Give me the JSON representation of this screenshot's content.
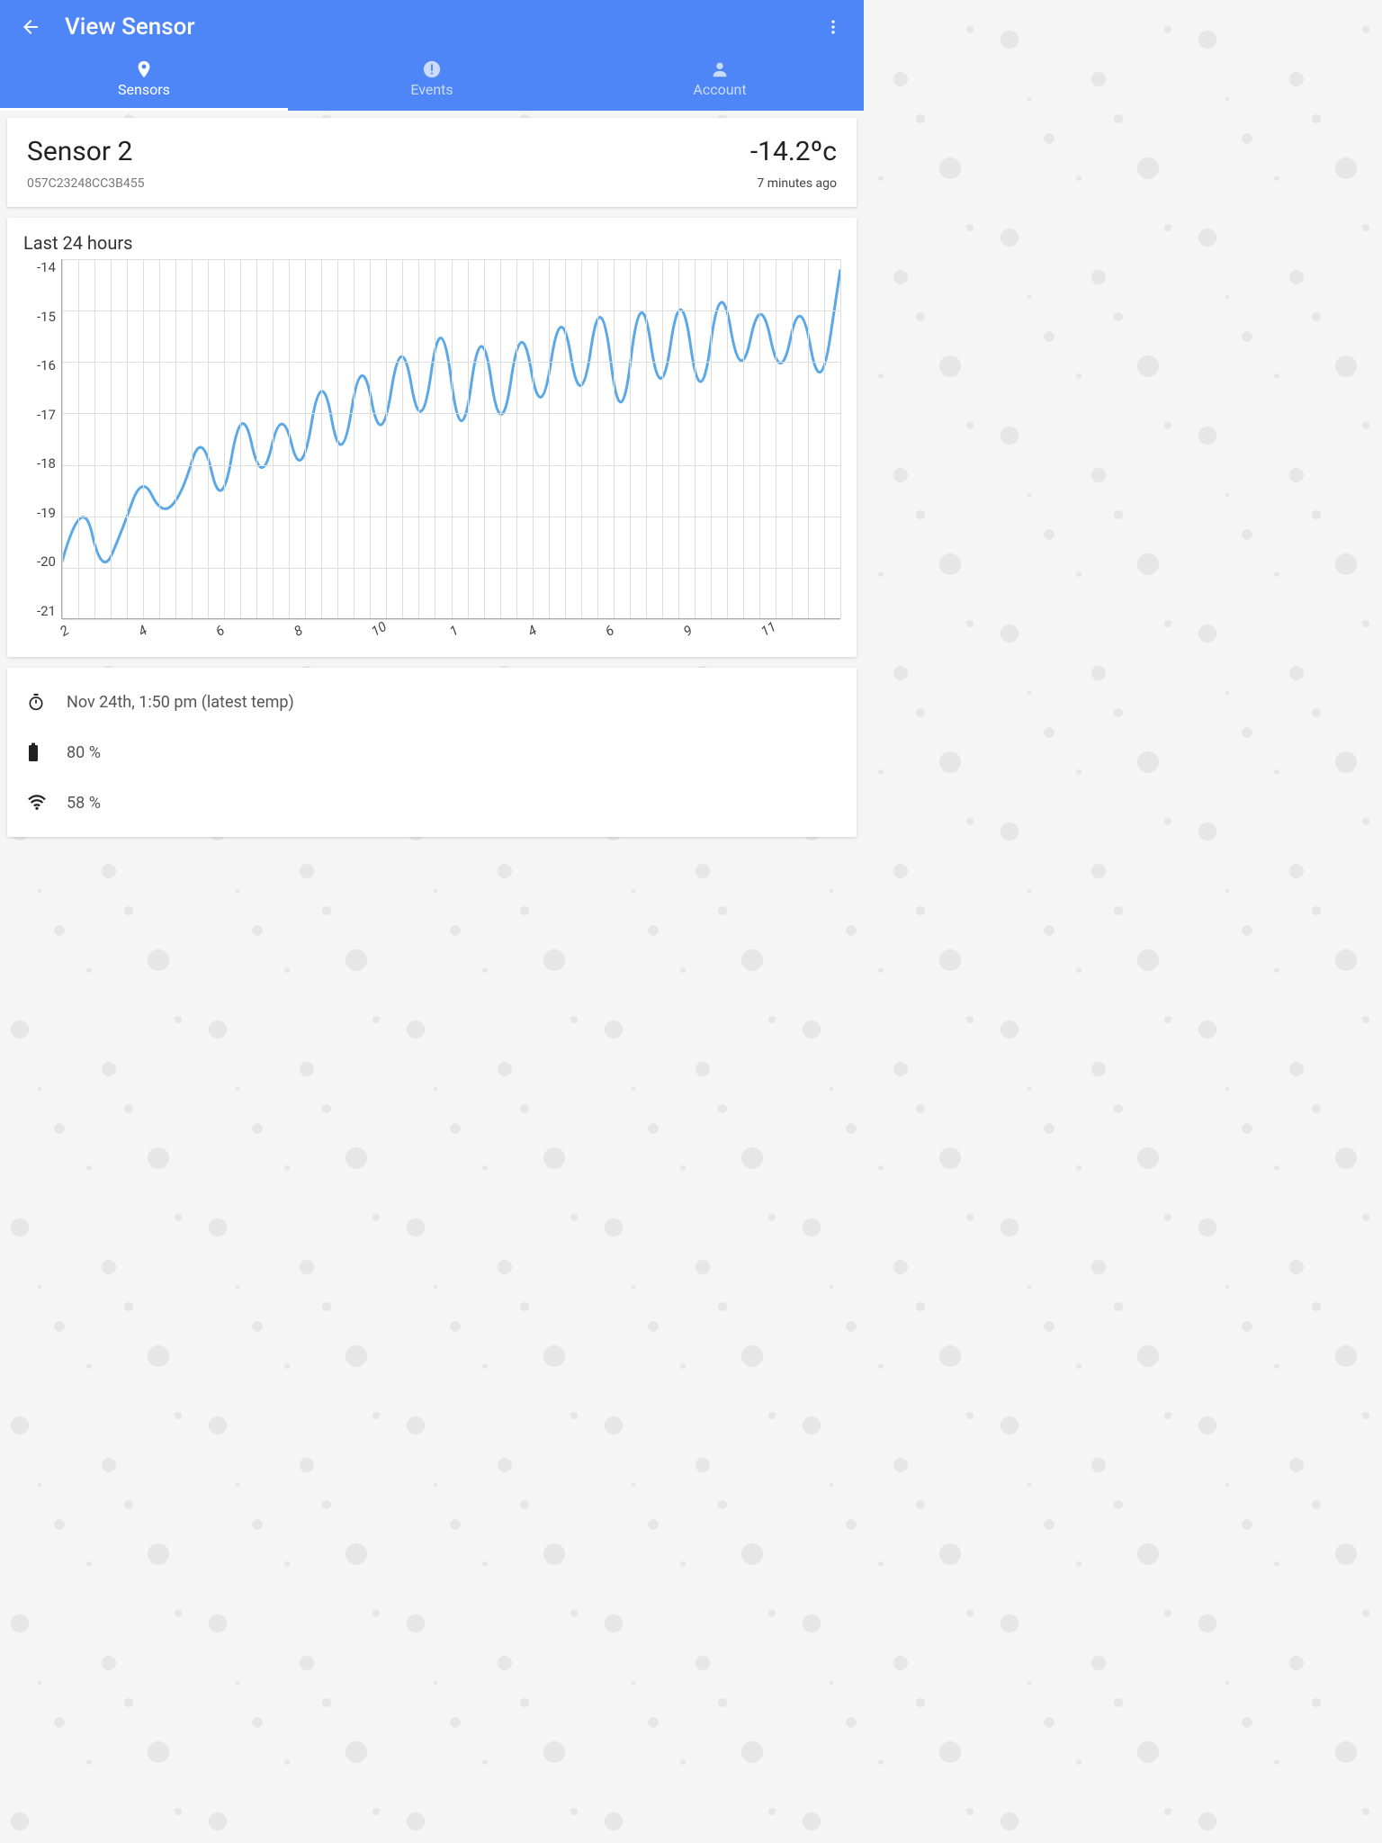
{
  "header": {
    "title": "View Sensor"
  },
  "tabs": {
    "sensors": "Sensors",
    "events": "Events",
    "account": "Account",
    "active": "sensors"
  },
  "sensor": {
    "name": "Sensor 2",
    "code": "057C23248CC3B455",
    "temperature": "-14.2ºc",
    "updated": "7 minutes ago"
  },
  "chart_data": {
    "type": "line",
    "title": "Last 24 hours",
    "xlabel": "",
    "ylabel": "",
    "ylim": [
      -21,
      -14
    ],
    "y_ticks": [
      -14,
      -15,
      -16,
      -17,
      -18,
      -19,
      -20,
      -21
    ],
    "x_tick_labels": [
      "2",
      "4",
      "6",
      "8",
      "10",
      "1",
      "4",
      "6",
      "9",
      "11"
    ],
    "x": [
      0,
      1,
      2,
      3,
      4,
      5,
      6,
      7,
      8,
      9,
      10,
      11,
      12,
      13,
      14,
      15,
      16,
      17,
      18,
      19,
      20,
      21,
      22,
      23,
      24,
      25,
      26,
      27,
      28,
      29,
      30,
      31,
      32,
      33,
      34,
      35,
      36,
      37,
      38,
      39,
      40,
      41,
      42,
      43,
      44,
      45,
      46,
      47
    ],
    "values": [
      -19.9,
      -18.5,
      -20.2,
      -19.3,
      -18.2,
      -19.0,
      -18.6,
      -17.3,
      -19.0,
      -16.7,
      -18.5,
      -16.8,
      -18.4,
      -16.0,
      -18.2,
      -15.7,
      -17.8,
      -15.3,
      -17.6,
      -14.8,
      -17.9,
      -15.0,
      -17.7,
      -15.0,
      -17.3,
      -14.7,
      -17.1,
      -14.4,
      -17.6,
      -14.3,
      -17.0,
      -14.3,
      -17.1,
      -14.2,
      -16.5,
      -14.6,
      -16.5,
      -14.6,
      -16.8,
      -14.2
    ]
  },
  "status": {
    "latest_time": "Nov 24th, 1:50 pm (latest temp)",
    "battery": "80 %",
    "signal": "58 %"
  },
  "colors": {
    "primary": "#4F86F7",
    "line": "#5AA9E6"
  }
}
